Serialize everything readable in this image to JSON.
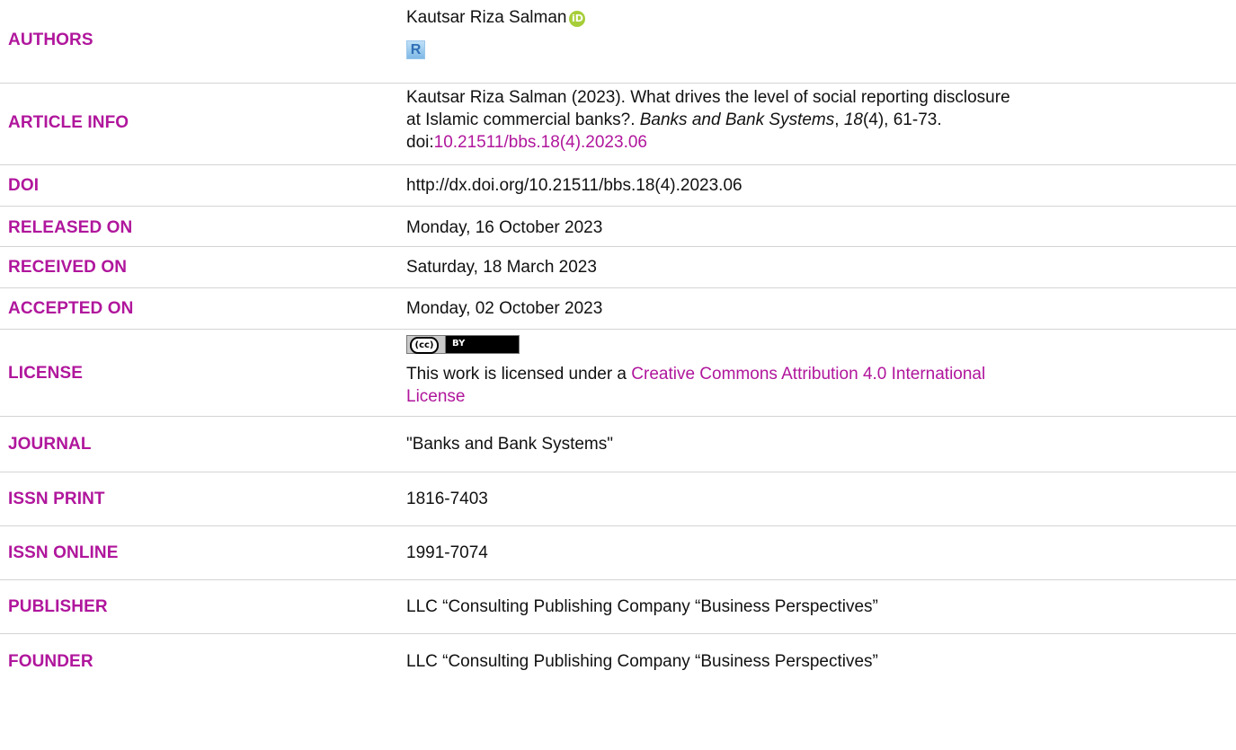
{
  "rows": {
    "authors": {
      "label": "AUTHORS",
      "name": "Kautsar Riza Salman",
      "orcid_icon": "orcid-icon",
      "researcherid_icon": "researcherid-icon",
      "researcherid_glyph": "R"
    },
    "article_info": {
      "label": "ARTICLE INFO",
      "line1": "Kautsar Riza Salman (2023). What drives the level of social reporting disclosure",
      "line2_pre": "at Islamic commercial banks?. ",
      "journal": "Banks and Bank Systems",
      "sep1": ", ",
      "volume": "18",
      "issue_pages": "(4), 61-73.",
      "doi_prefix": "doi:",
      "doi_link": "10.21511/bbs.18(4).2023.06"
    },
    "doi": {
      "label": "DOI",
      "value": "http://dx.doi.org/10.21511/bbs.18(4).2023.06"
    },
    "released": {
      "label": "RELEASED ON",
      "value": "Monday, 16 October 2023"
    },
    "received": {
      "label": "RECEIVED ON",
      "value": "Saturday, 18 March 2023"
    },
    "accepted": {
      "label": "ACCEPTED ON",
      "value": "Monday, 02 October 2023"
    },
    "license": {
      "label": "LICENSE",
      "badge_icon": "cc-by-badge-icon",
      "badge_cc": "(cc)",
      "badge_by": "BY",
      "text": "This work is licensed under a ",
      "link_line1": "Creative Commons Attribution 4.0 International",
      "link_line2": "License"
    },
    "journal": {
      "label": "JOURNAL",
      "value": "\"Banks and Bank Systems\""
    },
    "issn_print": {
      "label": "ISSN PRINT",
      "value": "1816-7403"
    },
    "issn_online": {
      "label": "ISSN ONLINE",
      "value": "1991-7074"
    },
    "publisher": {
      "label": "PUBLISHER",
      "value": "LLC “Consulting Publishing Company “Business Perspectives”"
    },
    "founder": {
      "label": "FOUNDER",
      "value": "LLC “Consulting Publishing Company “Business Perspectives”"
    }
  },
  "colors": {
    "label": "#b0169c",
    "link": "#b0169c",
    "divider": "#d4d4d4",
    "orcid": "#a6ce39"
  }
}
